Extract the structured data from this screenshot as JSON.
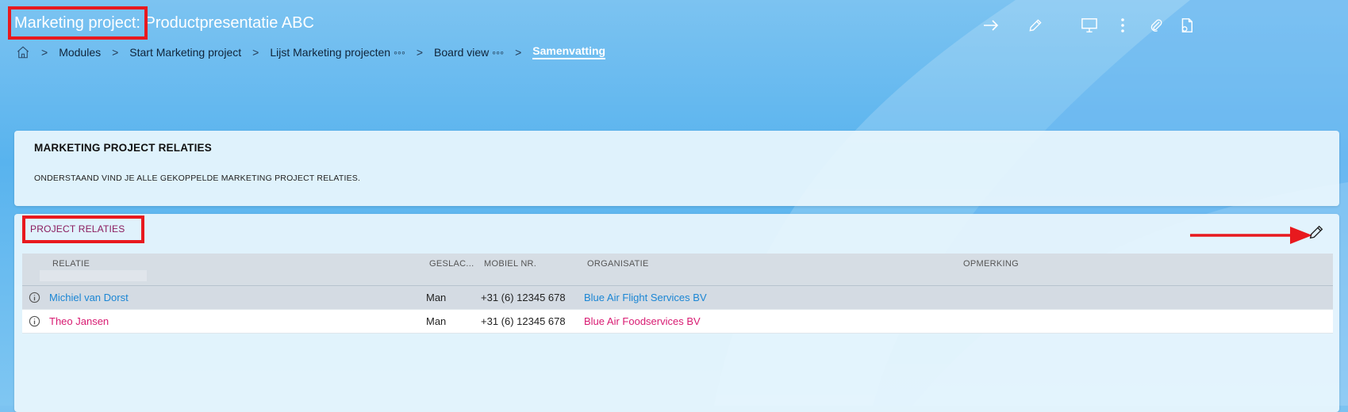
{
  "header": {
    "title": "Marketing project: Productpresentatie ABC"
  },
  "toolbar": {
    "icons": [
      "arrow-right-icon",
      "pencil-icon",
      "monitor-icon",
      "more-vertical-icon",
      "paperclip-icon",
      "document-copy-icon"
    ]
  },
  "breadcrumb": {
    "items": [
      "Modules",
      "Start Marketing project",
      "Lijst Marketing projecten ◦◦◦",
      "Board view ◦◦◦",
      "Samenvatting"
    ]
  },
  "summary_card": {
    "heading": "MARKETING PROJECT RELATIES",
    "description": "ONDERSTAAND VIND JE ALLE GEKOPPELDE MARKETING PROJECT RELATIES."
  },
  "relations": {
    "title": "PROJECT RELATIES",
    "columns": [
      "RELATIE",
      "GESLAC...",
      "MOBIEL NR.",
      "ORGANISATIE",
      "OPMERKING"
    ],
    "rows": [
      {
        "relatie": "Michiel van Dorst",
        "geslacht": "Man",
        "mobiel": "+31 (6) 12345 678",
        "organisatie": "Blue Air Flight Services BV",
        "opmerking": ""
      },
      {
        "relatie": "Theo Jansen",
        "geslacht": "Man",
        "mobiel": "+31 (6) 12345 678",
        "organisatie": "Blue Air Foodservices BV",
        "opmerking": ""
      }
    ]
  },
  "colors": {
    "accent_red": "#e8191e",
    "link_blue": "#1b86d4",
    "link_pink": "#d81b72",
    "section_title": "#8a1b5e"
  }
}
